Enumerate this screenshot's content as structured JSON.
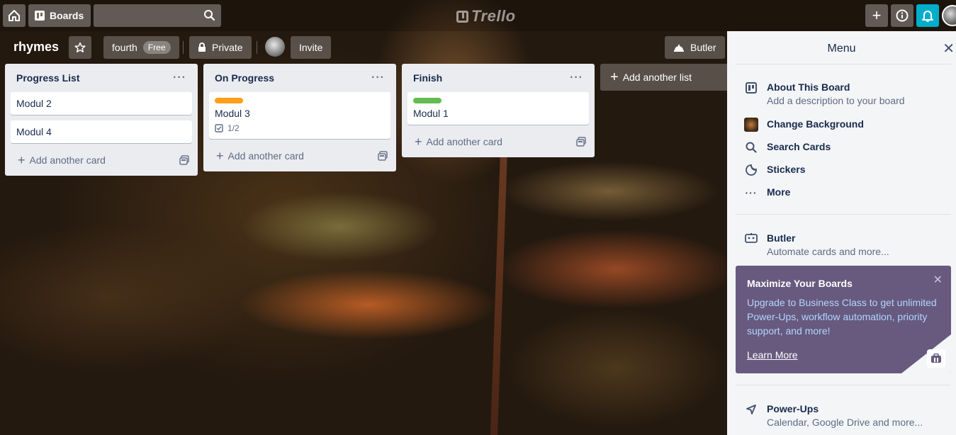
{
  "header": {
    "boards_label": "Boards",
    "search_placeholder": "",
    "logo_text": "Trello"
  },
  "board": {
    "title": "rhymes",
    "team_name": "fourth",
    "team_badge": "Free",
    "visibility": "Private",
    "invite_label": "Invite",
    "butler_label": "Butler"
  },
  "lists": [
    {
      "title": "Progress List",
      "cards": [
        {
          "title": "Modul 2"
        },
        {
          "title": "Modul 4"
        }
      ],
      "add_card": "Add another card"
    },
    {
      "title": "On Progress",
      "cards": [
        {
          "title": "Modul 3",
          "label_color": "#ff9f1a",
          "checklist": "1/2"
        }
      ],
      "add_card": "Add another card"
    },
    {
      "title": "Finish",
      "cards": [
        {
          "title": "Modul 1",
          "label_color": "#61bd4f"
        }
      ],
      "add_card": "Add another card"
    }
  ],
  "add_list_label": "Add another list",
  "menu": {
    "title": "Menu",
    "items": [
      {
        "title": "About This Board",
        "subtitle": "Add a description to your board",
        "icon": "board-icon"
      },
      {
        "title": "Change Background",
        "icon": "background-thumbnail"
      },
      {
        "title": "Search Cards",
        "icon": "search-icon"
      },
      {
        "title": "Stickers",
        "icon": "sticker-icon"
      },
      {
        "title": "More",
        "icon": "more-icon"
      }
    ],
    "butler": {
      "title": "Butler",
      "subtitle": "Automate cards and more..."
    },
    "promo": {
      "title": "Maximize Your Boards",
      "body": "Upgrade to Business Class to get unlimited Power-Ups, workflow automation, priority support, and more!",
      "link": "Learn More"
    },
    "powerups": {
      "title": "Power-Ups",
      "subtitle": "Calendar, Google Drive and more..."
    }
  },
  "colors": {
    "notification_bell": "#00aecc",
    "promo_background": "#675a7e",
    "label_orange": "#ff9f1a",
    "label_green": "#61bd4f"
  }
}
